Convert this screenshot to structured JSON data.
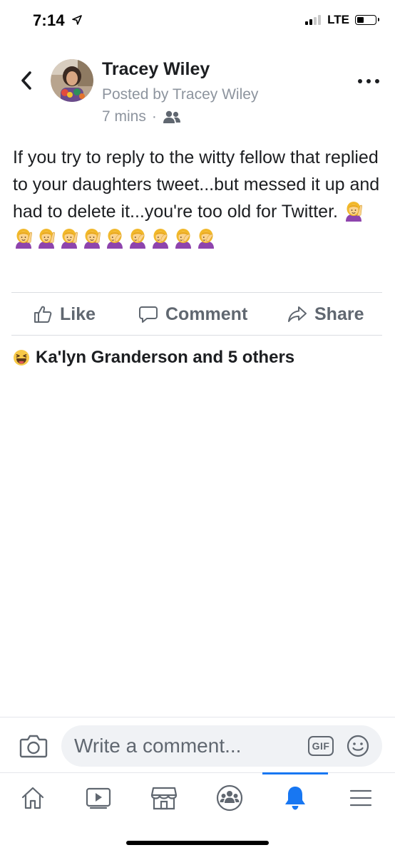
{
  "status_bar": {
    "time": "7:14",
    "network": "LTE"
  },
  "post": {
    "author": "Tracey Wiley",
    "posted_by": "Posted by Tracey Wiley",
    "time_ago": "7 mins",
    "separator": "·",
    "audience_icon": "friends-icon",
    "text": "If you try to reply to the witty fellow that replied to your daughters tweet...but messed it up and had to delete it...you're too old for Twitter.",
    "emojis": [
      "raising-hand",
      "raising-hand",
      "raising-hand",
      "raising-hand",
      "raising-hand",
      "facepalm",
      "facepalm",
      "facepalm",
      "facepalm",
      "facepalm"
    ]
  },
  "actions": {
    "like": "Like",
    "comment": "Comment",
    "share": "Share"
  },
  "reactions": {
    "summary": "Ka'lyn Granderson and 5 others",
    "icon": "haha-reaction"
  },
  "comment_bar": {
    "placeholder": "Write a comment...",
    "gif_label": "GIF"
  },
  "tabs": [
    {
      "name": "home",
      "active": false
    },
    {
      "name": "watch",
      "active": false
    },
    {
      "name": "marketplace",
      "active": false
    },
    {
      "name": "groups",
      "active": false
    },
    {
      "name": "notifications",
      "active": true
    },
    {
      "name": "menu",
      "active": false
    }
  ],
  "colors": {
    "accent": "#1877f2",
    "secondary_text": "#8d949e",
    "action_text": "#606770"
  }
}
